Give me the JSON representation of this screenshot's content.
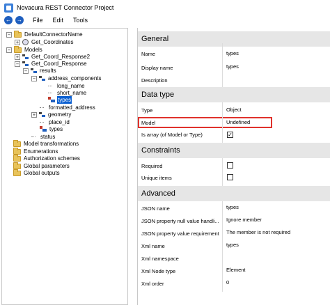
{
  "window": {
    "title": "Novacura REST Connector Project"
  },
  "menu": {
    "items": [
      "File",
      "Edit",
      "Tools"
    ],
    "back_glyph": "←",
    "forward_glyph": "→"
  },
  "tree": {
    "nodes": [
      {
        "label": "DefaultConnectorName",
        "icon": "folder-icon",
        "expander": "−",
        "selected": false
      },
      {
        "label": "Get_Coordinates",
        "icon": "globe-icon",
        "expander": "+",
        "selected": false
      },
      {
        "label": "Models",
        "icon": "folder-icon",
        "expander": "−",
        "selected": false
      },
      {
        "label": "Get_Coord_Response2",
        "icon": "node-icon",
        "expander": "+",
        "selected": false
      },
      {
        "label": "Get_Coord_Response",
        "icon": "node-icon",
        "expander": "−",
        "selected": false
      },
      {
        "label": "results",
        "icon": "node-icon",
        "expander": "−",
        "selected": false
      },
      {
        "label": "address_components",
        "icon": "node-icon",
        "expander": "−",
        "selected": false
      },
      {
        "label": "long_name",
        "icon": "leaf-icon",
        "expander": "",
        "selected": false
      },
      {
        "label": "short_name",
        "icon": "leaf-icon",
        "expander": "",
        "selected": false
      },
      {
        "label": "types",
        "icon": "type-icon",
        "expander": "",
        "selected": true
      },
      {
        "label": "formatted_address",
        "icon": "leaf-icon",
        "expander": "",
        "selected": false
      },
      {
        "label": "geometry",
        "icon": "node-icon",
        "expander": "+",
        "selected": false
      },
      {
        "label": "place_id",
        "icon": "leaf-icon",
        "expander": "",
        "selected": false
      },
      {
        "label": "types",
        "icon": "type-icon",
        "expander": "",
        "selected": false
      },
      {
        "label": "status",
        "icon": "leaf-icon",
        "expander": "",
        "selected": false
      },
      {
        "label": "Model transformations",
        "icon": "folder-icon",
        "expander": "",
        "selected": false
      },
      {
        "label": "Enumerations",
        "icon": "folder-icon",
        "expander": "",
        "selected": false
      },
      {
        "label": "Authorization schemes",
        "icon": "folder-icon",
        "expander": "",
        "selected": false
      },
      {
        "label": "Global parameters",
        "icon": "folder-icon",
        "expander": "",
        "selected": false
      },
      {
        "label": "Global outputs",
        "icon": "folder-icon",
        "expander": "",
        "selected": false
      }
    ]
  },
  "properties": {
    "general": {
      "header": "General",
      "name_label": "Name",
      "name_value": "types",
      "display_label": "Display name",
      "display_value": "types",
      "description_label": "Description",
      "description_value": ""
    },
    "datatype": {
      "header": "Data type",
      "type_label": "Type",
      "type_value": "Object",
      "model_label": "Model",
      "model_value": "Undefined",
      "isarray_label": "Is array (of Model or Type)",
      "isarray_checked": true,
      "check_glyph": "✓"
    },
    "constraints": {
      "header": "Constraints",
      "required_label": "Required",
      "required_checked": false,
      "unique_label": "Unique items",
      "unique_checked": false
    },
    "advanced": {
      "header": "Advanced",
      "json_name_label": "JSON name",
      "json_name_value": "types",
      "null_handling_label": "JSON property null value handli...",
      "null_handling_value": "Ignore member",
      "value_req_label": "JSON property value requirement",
      "value_req_value": "The member is not required",
      "xml_name_label": "Xml name",
      "xml_name_value": "types",
      "xml_ns_label": "Xml namespace",
      "xml_ns_value": "",
      "xml_node_label": "Xml Node type",
      "xml_node_value": "Element",
      "xml_order_label": "Xml order",
      "xml_order_value": "0"
    }
  }
}
